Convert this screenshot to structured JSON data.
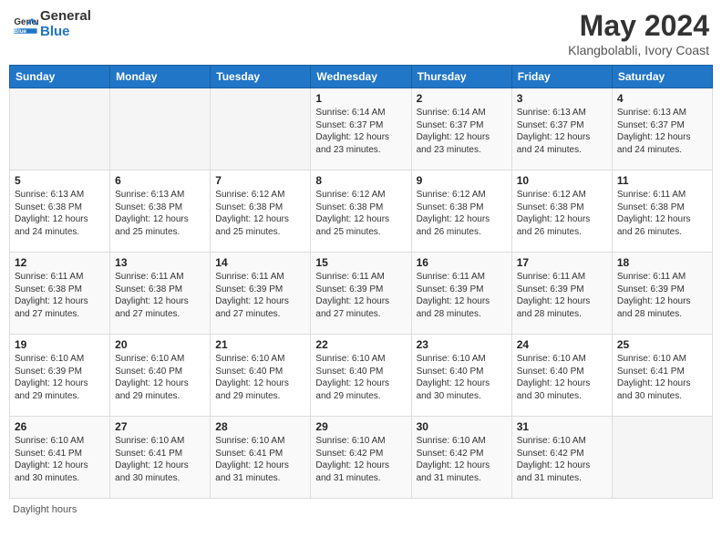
{
  "header": {
    "logo_general": "General",
    "logo_blue": "Blue",
    "month_title": "May 2024",
    "location": "Klangbolabli, Ivory Coast"
  },
  "days_of_week": [
    "Sunday",
    "Monday",
    "Tuesday",
    "Wednesday",
    "Thursday",
    "Friday",
    "Saturday"
  ],
  "weeks": [
    [
      {
        "day": "",
        "info": ""
      },
      {
        "day": "",
        "info": ""
      },
      {
        "day": "",
        "info": ""
      },
      {
        "day": "1",
        "sunrise": "6:14 AM",
        "sunset": "6:37 PM",
        "daylight": "12 hours and 23 minutes."
      },
      {
        "day": "2",
        "sunrise": "6:14 AM",
        "sunset": "6:37 PM",
        "daylight": "12 hours and 23 minutes."
      },
      {
        "day": "3",
        "sunrise": "6:13 AM",
        "sunset": "6:37 PM",
        "daylight": "12 hours and 24 minutes."
      },
      {
        "day": "4",
        "sunrise": "6:13 AM",
        "sunset": "6:37 PM",
        "daylight": "12 hours and 24 minutes."
      }
    ],
    [
      {
        "day": "5",
        "sunrise": "6:13 AM",
        "sunset": "6:38 PM",
        "daylight": "12 hours and 24 minutes."
      },
      {
        "day": "6",
        "sunrise": "6:13 AM",
        "sunset": "6:38 PM",
        "daylight": "12 hours and 25 minutes."
      },
      {
        "day": "7",
        "sunrise": "6:12 AM",
        "sunset": "6:38 PM",
        "daylight": "12 hours and 25 minutes."
      },
      {
        "day": "8",
        "sunrise": "6:12 AM",
        "sunset": "6:38 PM",
        "daylight": "12 hours and 25 minutes."
      },
      {
        "day": "9",
        "sunrise": "6:12 AM",
        "sunset": "6:38 PM",
        "daylight": "12 hours and 26 minutes."
      },
      {
        "day": "10",
        "sunrise": "6:12 AM",
        "sunset": "6:38 PM",
        "daylight": "12 hours and 26 minutes."
      },
      {
        "day": "11",
        "sunrise": "6:11 AM",
        "sunset": "6:38 PM",
        "daylight": "12 hours and 26 minutes."
      }
    ],
    [
      {
        "day": "12",
        "sunrise": "6:11 AM",
        "sunset": "6:38 PM",
        "daylight": "12 hours and 27 minutes."
      },
      {
        "day": "13",
        "sunrise": "6:11 AM",
        "sunset": "6:38 PM",
        "daylight": "12 hours and 27 minutes."
      },
      {
        "day": "14",
        "sunrise": "6:11 AM",
        "sunset": "6:39 PM",
        "daylight": "12 hours and 27 minutes."
      },
      {
        "day": "15",
        "sunrise": "6:11 AM",
        "sunset": "6:39 PM",
        "daylight": "12 hours and 27 minutes."
      },
      {
        "day": "16",
        "sunrise": "6:11 AM",
        "sunset": "6:39 PM",
        "daylight": "12 hours and 28 minutes."
      },
      {
        "day": "17",
        "sunrise": "6:11 AM",
        "sunset": "6:39 PM",
        "daylight": "12 hours and 28 minutes."
      },
      {
        "day": "18",
        "sunrise": "6:11 AM",
        "sunset": "6:39 PM",
        "daylight": "12 hours and 28 minutes."
      }
    ],
    [
      {
        "day": "19",
        "sunrise": "6:10 AM",
        "sunset": "6:39 PM",
        "daylight": "12 hours and 29 minutes."
      },
      {
        "day": "20",
        "sunrise": "6:10 AM",
        "sunset": "6:40 PM",
        "daylight": "12 hours and 29 minutes."
      },
      {
        "day": "21",
        "sunrise": "6:10 AM",
        "sunset": "6:40 PM",
        "daylight": "12 hours and 29 minutes."
      },
      {
        "day": "22",
        "sunrise": "6:10 AM",
        "sunset": "6:40 PM",
        "daylight": "12 hours and 29 minutes."
      },
      {
        "day": "23",
        "sunrise": "6:10 AM",
        "sunset": "6:40 PM",
        "daylight": "12 hours and 30 minutes."
      },
      {
        "day": "24",
        "sunrise": "6:10 AM",
        "sunset": "6:40 PM",
        "daylight": "12 hours and 30 minutes."
      },
      {
        "day": "25",
        "sunrise": "6:10 AM",
        "sunset": "6:41 PM",
        "daylight": "12 hours and 30 minutes."
      }
    ],
    [
      {
        "day": "26",
        "sunrise": "6:10 AM",
        "sunset": "6:41 PM",
        "daylight": "12 hours and 30 minutes."
      },
      {
        "day": "27",
        "sunrise": "6:10 AM",
        "sunset": "6:41 PM",
        "daylight": "12 hours and 30 minutes."
      },
      {
        "day": "28",
        "sunrise": "6:10 AM",
        "sunset": "6:41 PM",
        "daylight": "12 hours and 31 minutes."
      },
      {
        "day": "29",
        "sunrise": "6:10 AM",
        "sunset": "6:42 PM",
        "daylight": "12 hours and 31 minutes."
      },
      {
        "day": "30",
        "sunrise": "6:10 AM",
        "sunset": "6:42 PM",
        "daylight": "12 hours and 31 minutes."
      },
      {
        "day": "31",
        "sunrise": "6:10 AM",
        "sunset": "6:42 PM",
        "daylight": "12 hours and 31 minutes."
      },
      {
        "day": "",
        "info": ""
      }
    ]
  ],
  "footer": {
    "daylight_label": "Daylight hours"
  }
}
